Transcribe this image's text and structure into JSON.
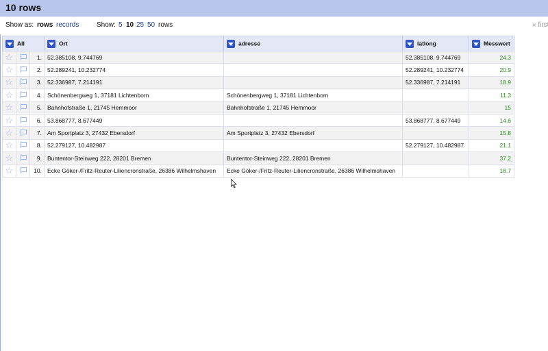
{
  "header": {
    "title": "10 rows"
  },
  "viewbar": {
    "show_as_label": "Show as:",
    "view_rows": "rows",
    "view_records": "records",
    "show_label": "Show:",
    "sizes": [
      "5",
      "10",
      "25",
      "50"
    ],
    "size_suffix": "rows",
    "pager_first": "« first"
  },
  "columns": {
    "all": "All",
    "ort": "Ort",
    "adresse": "adresse",
    "latlong": "latlong",
    "messwert": "Messwert"
  },
  "rows": [
    {
      "index": "1.",
      "ort": "52.385108, 9.744769",
      "adresse": "",
      "latlong": "52.385108, 9.744769",
      "messwert": "24.3"
    },
    {
      "index": "2.",
      "ort": "52.289241, 10.232774",
      "adresse": "",
      "latlong": "52.289241, 10.232774",
      "messwert": "20.9"
    },
    {
      "index": "3.",
      "ort": "52.336987, 7.214191",
      "adresse": "",
      "latlong": "52.336987, 7.214191",
      "messwert": "18.9"
    },
    {
      "index": "4.",
      "ort": "Schönenbergweg 1, 37181 Lichtenborn",
      "adresse": "Schönenbergweg 1, 37181 Lichtenborn",
      "latlong": "",
      "messwert": "11.3"
    },
    {
      "index": "5.",
      "ort": "Bahnhofstraße 1, 21745 Hemmoor",
      "adresse": "Bahnhofstraße 1, 21745 Hemmoor",
      "latlong": "",
      "messwert": "15"
    },
    {
      "index": "6.",
      "ort": "53.868777, 8.677449",
      "adresse": "",
      "latlong": "53.868777, 8.677449",
      "messwert": "14.6"
    },
    {
      "index": "7.",
      "ort": "Am Sportplatz 3, 27432 Ebersdorf",
      "adresse": "Am Sportplatz 3, 27432 Ebersdorf",
      "latlong": "",
      "messwert": "15.8"
    },
    {
      "index": "8.",
      "ort": "52.279127, 10.482987",
      "adresse": "",
      "latlong": "52.279127, 10.482987",
      "messwert": "21.1"
    },
    {
      "index": "9.",
      "ort": "Buntentor-Steinweg 222, 28201 Bremen",
      "adresse": "Buntentor-Steinweg 222, 28201 Bremen",
      "latlong": "",
      "messwert": "37.2"
    },
    {
      "index": "10.",
      "ort": "Ecke Göker-/Fritz-Reuter-Liliencronstraße, 26386 Wilhelmshaven",
      "adresse": "Ecke Göker-/Fritz-Reuter-Liliencronstraße, 26386 Wilhelmshaven",
      "latlong": "",
      "messwert": "18.7"
    }
  ],
  "icons": {
    "star": "star-icon",
    "flag": "flag-icon",
    "menu": "dropdown-menu-icon",
    "cursor": "mouse-pointer-icon"
  },
  "colors": {
    "header_bg": "#b8c5ec",
    "accent": "#2f55c7",
    "link": "#1f3f99",
    "measure_text": "#2a8a1e"
  }
}
